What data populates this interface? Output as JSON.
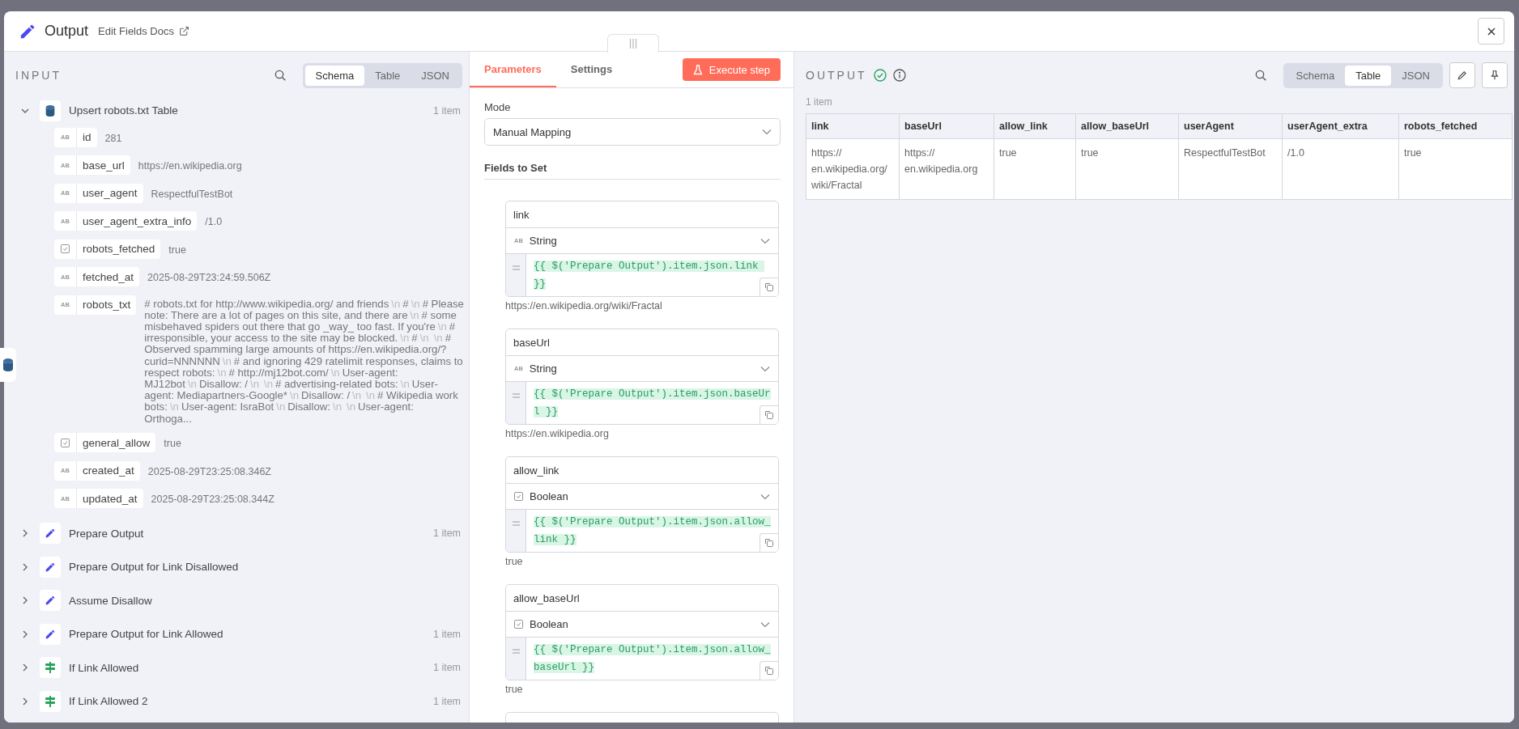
{
  "header": {
    "title": "Output",
    "docs_link": "Edit Fields Docs"
  },
  "input": {
    "label": "INPUT",
    "views": [
      {
        "label": "Schema",
        "selected": true
      },
      {
        "label": "Table",
        "selected": false
      },
      {
        "label": "JSON",
        "selected": false
      }
    ],
    "nodes": [
      {
        "kind": "database",
        "name": "Upsert robots.txt Table",
        "count": "1 item",
        "expanded": true,
        "fields": [
          {
            "kind": "string",
            "badge": "AB",
            "name": "id",
            "value": "281"
          },
          {
            "kind": "string",
            "badge": "AB",
            "name": "base_url",
            "value": "https://en.wikipedia.org"
          },
          {
            "kind": "string",
            "badge": "AB",
            "name": "user_agent",
            "value": "RespectfulTestBot"
          },
          {
            "kind": "string",
            "badge": "AB",
            "name": "user_agent_extra_info",
            "value": "/1.0"
          },
          {
            "kind": "boolean",
            "name": "robots_fetched",
            "value": "true"
          },
          {
            "kind": "string",
            "badge": "AB",
            "name": "fetched_at",
            "value": "2025-08-29T23:24:59.506Z"
          },
          {
            "kind": "string",
            "badge": "AB",
            "name": "robots_txt",
            "value_parts": [
              {
                "kind": "text",
                "text": "# robots.txt for http://www.wikipedia.org/ and friends"
              },
              {
                "kind": "escape",
                "text": "\\n"
              },
              {
                "kind": "text",
                "text": "#"
              },
              {
                "kind": "escape",
                "text": "\\n"
              },
              {
                "kind": "text",
                "text": "# Please note: There are a lot of pages on this site, and there are"
              },
              {
                "kind": "escape",
                "text": "\\n"
              },
              {
                "kind": "text",
                "text": "# some misbehaved spiders out there that go _way_ too fast. If you're"
              },
              {
                "kind": "escape",
                "text": "\\n"
              },
              {
                "kind": "text",
                "text": "# irresponsible, your access to the site may be blocked."
              },
              {
                "kind": "escape",
                "text": "\\n"
              },
              {
                "kind": "text",
                "text": "#"
              },
              {
                "kind": "escape",
                "text": "\\n"
              },
              {
                "kind": "escape",
                "text": "\\n"
              },
              {
                "kind": "text",
                "text": "# Observed spamming large amounts of https://en.wikipedia.org/?curid=NNNNNN"
              },
              {
                "kind": "escape",
                "text": "\\n"
              },
              {
                "kind": "text",
                "text": "# and ignoring 429 ratelimit responses, claims to respect robots:"
              },
              {
                "kind": "escape",
                "text": "\\n"
              },
              {
                "kind": "text",
                "text": "# http://mj12bot.com/"
              },
              {
                "kind": "escape",
                "text": "\\n"
              },
              {
                "kind": "text",
                "text": "User-agent: MJ12bot"
              },
              {
                "kind": "escape",
                "text": "\\n"
              },
              {
                "kind": "text",
                "text": "Disallow: /"
              },
              {
                "kind": "escape",
                "text": "\\n"
              },
              {
                "kind": "escape",
                "text": "\\n"
              },
              {
                "kind": "text",
                "text": "# advertising-related bots:"
              },
              {
                "kind": "escape",
                "text": "\\n"
              },
              {
                "kind": "text",
                "text": "User-agent: Mediapartners-Google*"
              },
              {
                "kind": "escape",
                "text": "\\n"
              },
              {
                "kind": "text",
                "text": "Disallow: /"
              },
              {
                "kind": "escape",
                "text": "\\n"
              },
              {
                "kind": "escape",
                "text": "\\n"
              },
              {
                "kind": "text",
                "text": "# Wikipedia work bots:"
              },
              {
                "kind": "escape",
                "text": "\\n"
              },
              {
                "kind": "text",
                "text": "User-agent: IsraBot"
              },
              {
                "kind": "escape",
                "text": "\\n"
              },
              {
                "kind": "text",
                "text": "Disallow:"
              },
              {
                "kind": "escape",
                "text": "\\n"
              },
              {
                "kind": "escape",
                "text": "\\n"
              },
              {
                "kind": "text",
                "text": "User-agent: Orthoga..."
              }
            ]
          },
          {
            "kind": "boolean",
            "name": "general_allow",
            "value": "true"
          },
          {
            "kind": "string",
            "badge": "AB",
            "name": "created_at",
            "value": "2025-08-29T23:25:08.346Z"
          },
          {
            "kind": "string",
            "badge": "AB",
            "name": "updated_at",
            "value": "2025-08-29T23:25:08.344Z"
          }
        ]
      },
      {
        "kind": "edit",
        "name": "Prepare Output",
        "count": "1 item",
        "expanded": false
      },
      {
        "kind": "edit",
        "name": "Prepare Output for Link Disallowed",
        "expanded": false
      },
      {
        "kind": "edit",
        "name": "Assume Disallow",
        "expanded": false
      },
      {
        "kind": "edit",
        "name": "Prepare Output for Link Allowed",
        "count": "1 item",
        "expanded": false
      },
      {
        "kind": "if",
        "name": "If Link Allowed",
        "count": "1 item",
        "expanded": false
      },
      {
        "kind": "if",
        "name": "If Link Allowed 2",
        "count": "1 item",
        "expanded": false
      }
    ]
  },
  "params": {
    "tabs": [
      {
        "label": "Parameters",
        "selected": true
      },
      {
        "label": "Settings",
        "selected": false
      }
    ],
    "execute": "Execute step",
    "mode_label": "Mode",
    "mode": "Manual Mapping",
    "fields_label": "Fields to Set",
    "fields": [
      {
        "name": "link",
        "kind": "string",
        "badge": "AB",
        "type_label": "String",
        "expression": "{{ $('Prepare Output').item.json.link }}",
        "result": "https://en.wikipedia.org/wiki/Fractal"
      },
      {
        "name": "baseUrl",
        "kind": "string",
        "badge": "AB",
        "type_label": "String",
        "expression": "{{ $('Prepare Output').item.json.baseUrl }}",
        "result": "https://en.wikipedia.org"
      },
      {
        "name": "allow_link",
        "kind": "boolean",
        "type_label": "Boolean",
        "expression": "{{ $('Prepare Output').item.json.allow_link }}",
        "result": "true"
      },
      {
        "name": "allow_baseUrl",
        "kind": "boolean",
        "type_label": "Boolean",
        "expression": "{{ $('Prepare Output').item.json.allow_baseUrl }}",
        "result": "true"
      }
    ]
  },
  "output": {
    "label": "OUTPUT",
    "success": true,
    "views": [
      {
        "label": "Schema",
        "selected": false
      },
      {
        "label": "Table",
        "selected": true
      },
      {
        "label": "JSON",
        "selected": false
      }
    ],
    "count": "1 item",
    "columns": [
      "link",
      "baseUrl",
      "allow_link",
      "allow_baseUrl",
      "userAgent",
      "userAgent_extra",
      "robots_fetched"
    ],
    "rows": [
      [
        "https:// en.wikipedia.org/ wiki/Fractal",
        "https:// en.wikipedia.org",
        "true",
        "true",
        "RespectfulTestBot",
        "/1.0",
        "true"
      ]
    ]
  }
}
